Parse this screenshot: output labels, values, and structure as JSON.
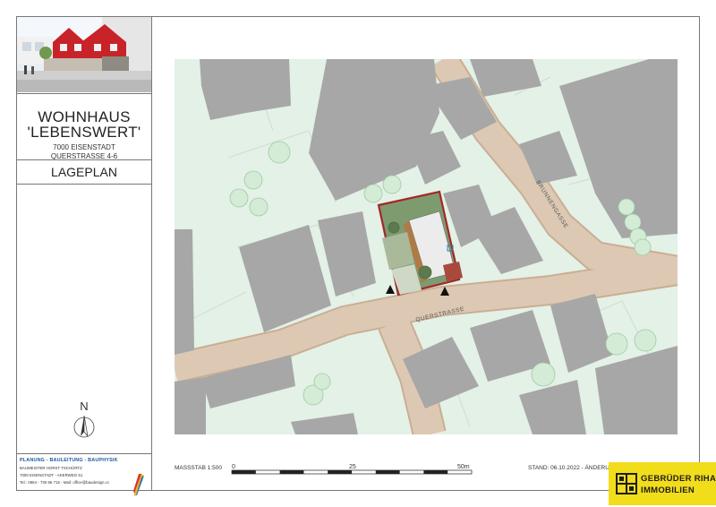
{
  "project": {
    "title_line1": "WOHNHAUS",
    "title_line2": "'LEBENSWERT'",
    "address_line1": "7000 EISENSTADT",
    "address_line2": "QUERSTRASSE 4-6"
  },
  "plan": {
    "name": "LAGEPLAN",
    "street_labels": [
      "QUERSTRASSE",
      "BRUNNENGASSE"
    ]
  },
  "north": {
    "label": "N"
  },
  "scale": {
    "label": "MASSSTAB 1:500",
    "ticks": [
      "0",
      "25",
      "50m"
    ]
  },
  "status": {
    "text": "STAND: 06.10.2022 - ÄNDERU"
  },
  "credits": {
    "heading": "PLANUNG - BAULEITUNG - BAUPHYSIK",
    "line1": "BAUMEISTER HORST TSCHÜRTZ",
    "line2": "7000 EISENSTADT - AKERWEG 51",
    "line3": "Tel.: 0664 - 730 66 715 - Mail: office@bau­design.cc"
  },
  "logo": {
    "line1": "GEBRÜDER RIHA",
    "line2": "IMMOBILIEN"
  },
  "colors": {
    "ground": "#e3f1e6",
    "building": "#a7a7a7",
    "road": "#ddc9b3",
    "road_edge": "#c9ae94",
    "plot_outline": "#a3272b",
    "logo_bg": "#f2dd1a",
    "credit_blue": "#1a5aa0"
  }
}
